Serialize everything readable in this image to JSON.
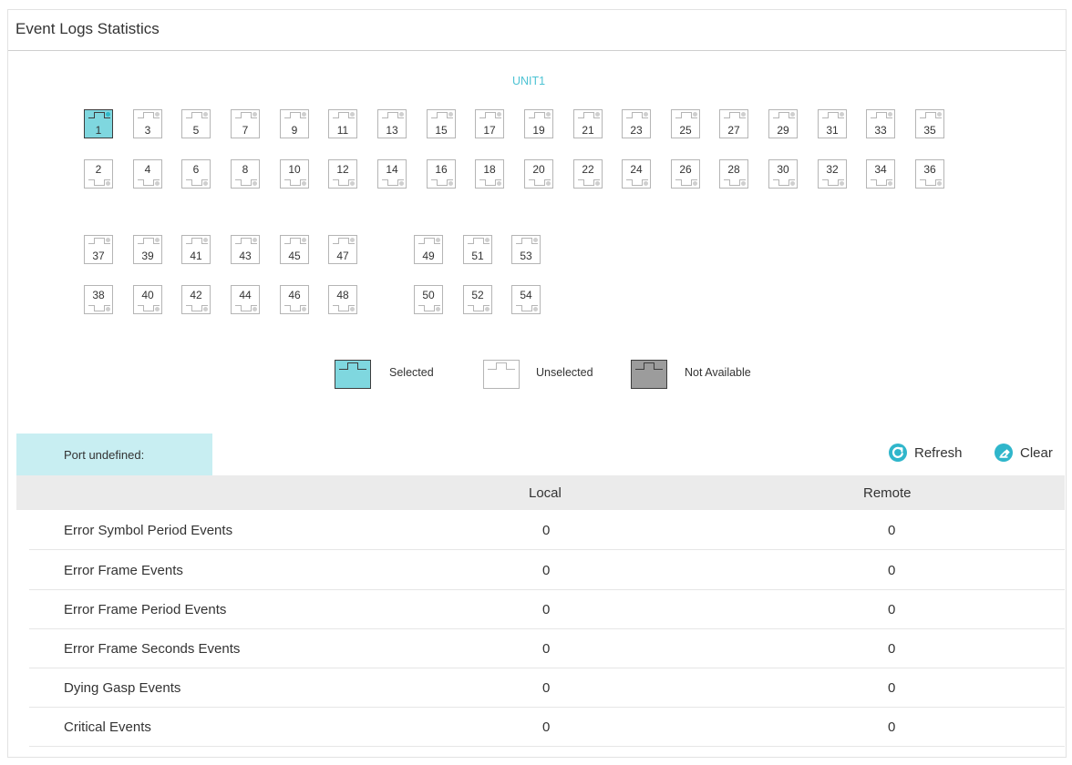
{
  "panel": {
    "title": "Event Logs Statistics"
  },
  "unit": {
    "label": "UNIT1"
  },
  "ports": {
    "group1_top": [
      "1",
      "3",
      "5",
      "7",
      "9",
      "11",
      "13",
      "15",
      "17",
      "19",
      "21",
      "23",
      "25",
      "27",
      "29",
      "31",
      "33",
      "35"
    ],
    "group1_bottom": [
      "2",
      "4",
      "6",
      "8",
      "10",
      "12",
      "14",
      "16",
      "18",
      "20",
      "22",
      "24",
      "26",
      "28",
      "30",
      "32",
      "34",
      "36"
    ],
    "group2_top": [
      "37",
      "39",
      "41",
      "43",
      "45",
      "47"
    ],
    "group2_bottom": [
      "38",
      "40",
      "42",
      "44",
      "46",
      "48"
    ],
    "group3_top": [
      "49",
      "51",
      "53"
    ],
    "group3_bottom": [
      "50",
      "52",
      "54"
    ],
    "selected": [
      "1"
    ]
  },
  "legend": {
    "selected_label": "Selected",
    "unselected_label": "Unselected",
    "not_available_label": "Not Available"
  },
  "port_tab": {
    "label": "Port undefined:"
  },
  "actions": {
    "refresh_label": "Refresh",
    "clear_label": "Clear"
  },
  "table": {
    "columns": [
      "",
      "Local",
      "Remote"
    ],
    "rows": [
      {
        "name": "Error Symbol Period Events",
        "local": "0",
        "remote": "0"
      },
      {
        "name": "Error Frame Events",
        "local": "0",
        "remote": "0"
      },
      {
        "name": "Error Frame Period Events",
        "local": "0",
        "remote": "0"
      },
      {
        "name": "Error Frame Seconds Events",
        "local": "0",
        "remote": "0"
      },
      {
        "name": "Dying Gasp Events",
        "local": "0",
        "remote": "0"
      },
      {
        "name": "Critical Events",
        "local": "0",
        "remote": "0"
      }
    ]
  },
  "colors": {
    "accent": "#2fb6cb",
    "unit_label": "#4dc3d4",
    "selected_port": "#7fd7df",
    "not_available_port": "#9c9c9c",
    "port_tab_bg": "#c8eef2",
    "table_header_bg": "#ebebeb"
  },
  "icons": {
    "refresh": "refresh-icon",
    "clear": "eraser-icon"
  }
}
